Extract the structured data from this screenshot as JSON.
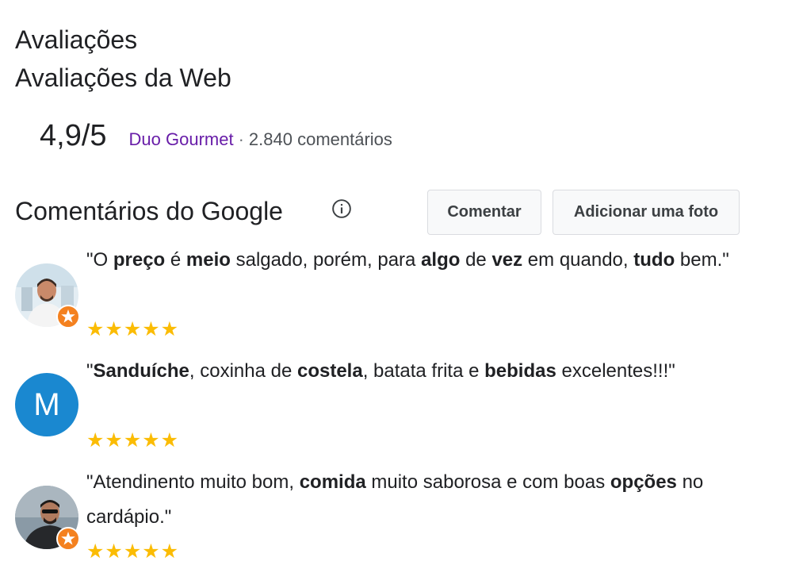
{
  "header": {
    "title": "Avaliações",
    "subtitle": "Avaliações da Web"
  },
  "web_rating": {
    "score": "4,9/5",
    "source": "Duo Gourmet",
    "separator": "·",
    "count": "2.840 comentários"
  },
  "google_reviews": {
    "title": "Comentários do Google",
    "comment_button": "Comentar",
    "add_photo_button": "Adicionar uma foto",
    "reviews": [
      {
        "avatar_type": "photo",
        "stars": "★★★★★",
        "rating": 5,
        "text_parts": [
          {
            "t": "\"O ",
            "b": false
          },
          {
            "t": "preço",
            "b": true
          },
          {
            "t": " é ",
            "b": false
          },
          {
            "t": "meio",
            "b": true
          },
          {
            "t": " salgado, porém, para ",
            "b": false
          },
          {
            "t": "algo",
            "b": true
          },
          {
            "t": " de ",
            "b": false
          },
          {
            "t": "vez",
            "b": true
          },
          {
            "t": " em quando, ",
            "b": false
          },
          {
            "t": "tudo",
            "b": true
          },
          {
            "t": " bem.\"",
            "b": false
          }
        ]
      },
      {
        "avatar_type": "letter",
        "avatar_letter": "M",
        "avatar_color": "#1a88d0",
        "stars": "★★★★★",
        "rating": 5,
        "text_parts": [
          {
            "t": "\"",
            "b": false
          },
          {
            "t": "Sanduíche",
            "b": true
          },
          {
            "t": ", coxinha de ",
            "b": false
          },
          {
            "t": "costela",
            "b": true
          },
          {
            "t": ", batata frita e ",
            "b": false
          },
          {
            "t": "bebidas",
            "b": true
          },
          {
            "t": " excelentes!!!\"",
            "b": false
          }
        ]
      },
      {
        "avatar_type": "photo",
        "stars": "★★★★★",
        "rating": 5,
        "text_parts": [
          {
            "t": "\"Atendinento muito bom, ",
            "b": false
          },
          {
            "t": "comida",
            "b": true
          },
          {
            "t": " muito saborosa e com boas ",
            "b": false
          },
          {
            "t": "opções",
            "b": true
          },
          {
            "t": " no cardápio.\"",
            "b": false
          }
        ]
      }
    ]
  },
  "colors": {
    "source_link": "#681da8",
    "star": "#fbbc04",
    "badge": "#f4811f"
  }
}
